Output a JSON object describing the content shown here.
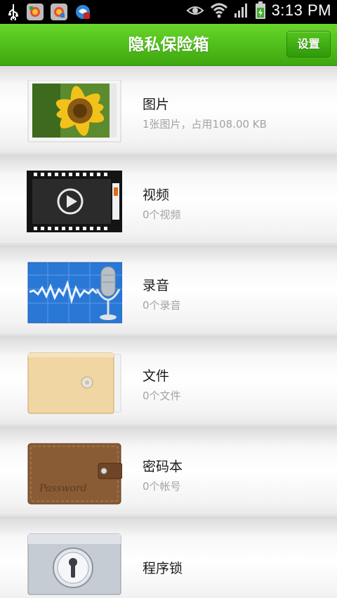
{
  "status_bar": {
    "time": "3:13 PM",
    "icons": [
      "usb-icon",
      "app-notification-icon",
      "app-notification-icon",
      "app-notification-icon",
      "eye-icon",
      "wifi-icon",
      "signal-icon",
      "battery-icon"
    ]
  },
  "header": {
    "title": "隐私保险箱",
    "settings_label": "设置",
    "accent": "#4fbd1a"
  },
  "items": [
    {
      "label": "图片",
      "detail": "1张图片，占用108.00 KB",
      "icon": "photo-sunflower-icon"
    },
    {
      "label": "视频",
      "detail": "0个视频",
      "icon": "video-film-icon"
    },
    {
      "label": "录音",
      "detail": "0个录音",
      "icon": "microphone-icon"
    },
    {
      "label": "文件",
      "detail": "0个文件",
      "icon": "folder-envelope-icon"
    },
    {
      "label": "密码本",
      "detail": "0个帐号",
      "icon": "wallet-icon",
      "wallet_text": "Password"
    },
    {
      "label": "程序锁",
      "detail": "",
      "icon": "lock-icon"
    }
  ]
}
